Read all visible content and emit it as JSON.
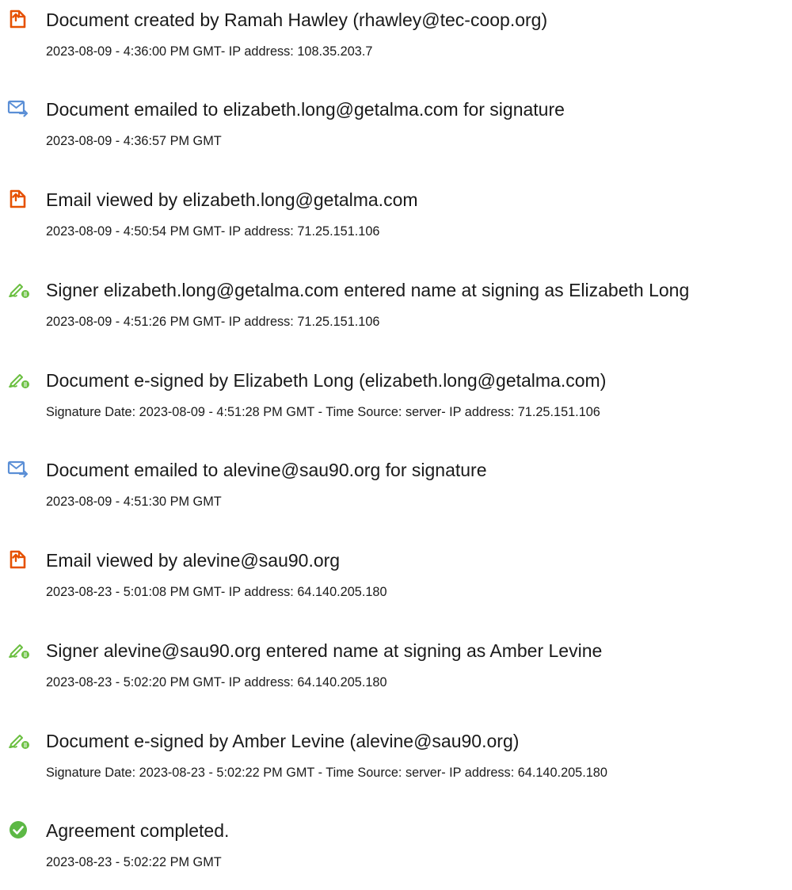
{
  "colors": {
    "created_icon": "#e65100",
    "email_icon": "#5b8fd6",
    "signature_icon": "#6abf40",
    "completed_icon": "#5cb845",
    "text": "#1a1a1a"
  },
  "events": [
    {
      "icon": "document-created-icon",
      "title": "Document created by Ramah Hawley (rhawley@tec-coop.org)",
      "detail": "2023-08-09 - 4:36:00 PM GMT- IP address: 108.35.203.7"
    },
    {
      "icon": "email-sent-icon",
      "title": "Document emailed to elizabeth.long@getalma.com for signature",
      "detail": "2023-08-09 - 4:36:57 PM GMT"
    },
    {
      "icon": "email-viewed-icon",
      "title": "Email viewed by elizabeth.long@getalma.com",
      "detail": "2023-08-09 - 4:50:54 PM GMT- IP address: 71.25.151.106"
    },
    {
      "icon": "signature-pen-icon",
      "title": "Signer elizabeth.long@getalma.com entered name at signing as Elizabeth Long",
      "detail": "2023-08-09 - 4:51:26 PM GMT- IP address: 71.25.151.106"
    },
    {
      "icon": "signature-pen-icon",
      "title": "Document e-signed by Elizabeth Long (elizabeth.long@getalma.com)",
      "detail": "Signature Date: 2023-08-09 - 4:51:28 PM GMT - Time Source: server- IP address: 71.25.151.106"
    },
    {
      "icon": "email-sent-icon",
      "title": "Document emailed to alevine@sau90.org for signature",
      "detail": "2023-08-09 - 4:51:30 PM GMT"
    },
    {
      "icon": "email-viewed-icon",
      "title": "Email viewed by alevine@sau90.org",
      "detail": "2023-08-23 - 5:01:08 PM GMT- IP address: 64.140.205.180"
    },
    {
      "icon": "signature-pen-icon",
      "title": "Signer alevine@sau90.org entered name at signing as Amber Levine",
      "detail": "2023-08-23 - 5:02:20 PM GMT- IP address: 64.140.205.180"
    },
    {
      "icon": "signature-pen-icon",
      "title": "Document e-signed by Amber Levine (alevine@sau90.org)",
      "detail": "Signature Date: 2023-08-23 - 5:02:22 PM GMT - Time Source: server- IP address: 64.140.205.180"
    },
    {
      "icon": "completed-check-icon",
      "title": "Agreement completed.",
      "detail": "2023-08-23 - 5:02:22 PM GMT"
    }
  ]
}
